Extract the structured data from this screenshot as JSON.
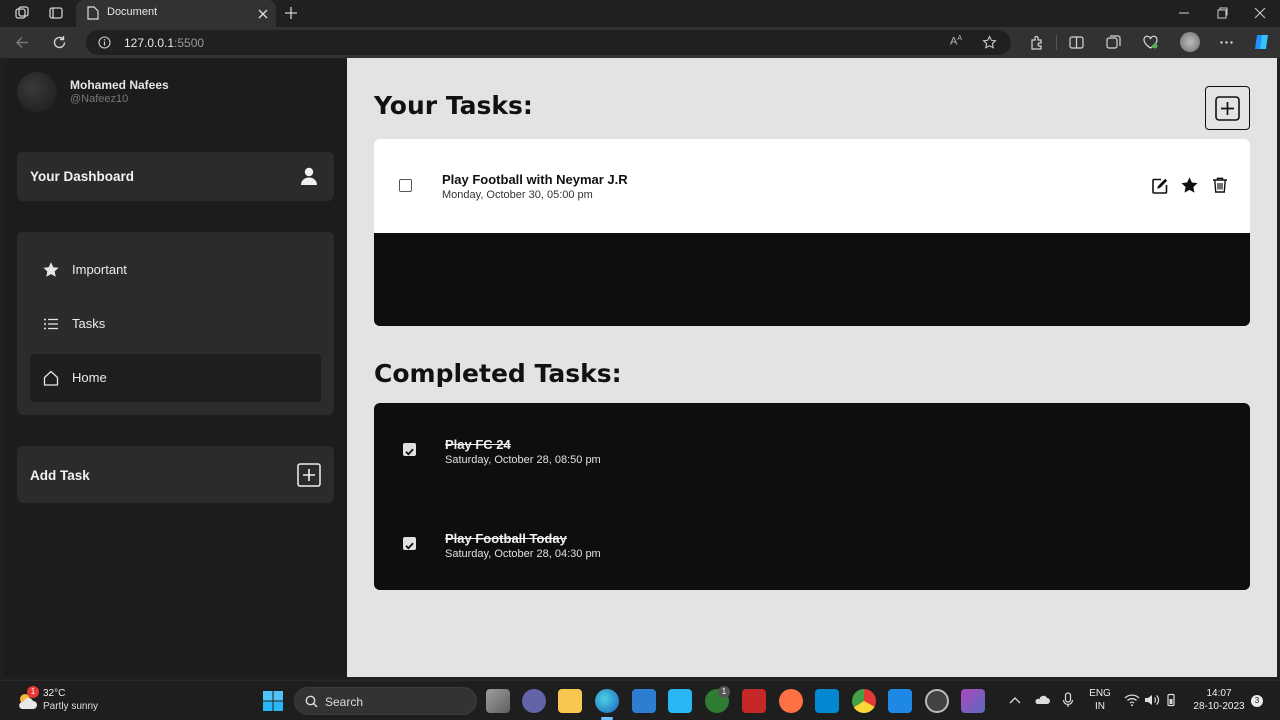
{
  "browser": {
    "tab_title": "Document",
    "address_host": "127.0.0.1",
    "address_port": ":5500"
  },
  "user": {
    "name": "Mohamed Nafees",
    "handle": "@Nafeez10"
  },
  "sidebar": {
    "dashboard_label": "Your Dashboard",
    "nav": [
      {
        "label": "Important",
        "icon": "star-icon"
      },
      {
        "label": "Tasks",
        "icon": "list-icon"
      },
      {
        "label": "Home",
        "icon": "home-icon",
        "active": true
      }
    ],
    "add_task_label": "Add Task"
  },
  "main": {
    "your_tasks_title": "Your Tasks:",
    "tasks": [
      {
        "name": "Play Football with Neymar J.R",
        "date": "Monday, October 30, 05:00 pm",
        "checked": false,
        "important": true
      }
    ],
    "completed_title": "Completed Tasks:",
    "completed": [
      {
        "name": "Play FC 24",
        "date": "Saturday, October 28, 08:50 pm",
        "checked": true
      },
      {
        "name": "Play Football Today",
        "date": "Saturday, October 28, 04:30 pm",
        "checked": true
      }
    ]
  },
  "taskbar": {
    "weather_temp": "32°C",
    "weather_desc": "Partly sunny",
    "weather_badge": "1",
    "search_placeholder": "Search",
    "xbox_badge": "1",
    "lang_line1": "ENG",
    "lang_line2": "IN",
    "time": "14:07",
    "date": "28-10-2023",
    "notif_count": "3"
  },
  "colors": {
    "sidebar_bg": "#1c1c1c",
    "panel_bg": "#2b2b2b",
    "main_bg": "#e3e3e3",
    "task_dark": "#0e0e0e"
  }
}
